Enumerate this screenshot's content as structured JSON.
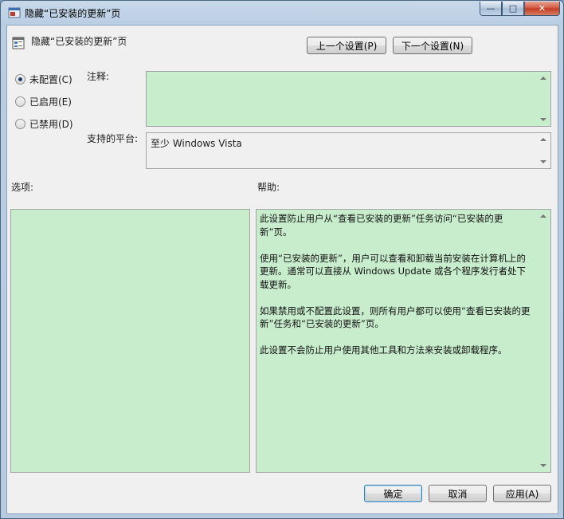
{
  "window": {
    "title": "隐藏“已安装的更新”页",
    "caption": {
      "minimize": "—",
      "maximize": "□",
      "close": "✕"
    }
  },
  "header": {
    "policy_title": "隐藏“已安装的更新”页",
    "prev_button": "上一个设置(P)",
    "next_button": "下一个设置(N)"
  },
  "state": {
    "options": [
      {
        "label": "未配置(C)",
        "selected": true
      },
      {
        "label": "已启用(E)",
        "selected": false
      },
      {
        "label": "已禁用(D)",
        "selected": false
      }
    ]
  },
  "comment": {
    "label": "注释:",
    "value": ""
  },
  "platform": {
    "label": "支持的平台:",
    "value": "至少 Windows Vista"
  },
  "options_section": {
    "label": "选项:"
  },
  "help_section": {
    "label": "帮助:",
    "paragraphs": [
      "此设置防止用户从“查看已安装的更新”任务访问“已安装的更新”页。",
      "使用“已安装的更新”，用户可以查看和卸载当前安装在计算机上的更新。通常可以直接从 Windows Update 或各个程序发行者处下载更新。",
      "如果禁用或不配置此设置，则所有用户都可以使用“查看已安装的更新”任务和“已安装的更新”页。",
      "此设置不会防止用户使用其他工具和方法来安装或卸载程序。"
    ]
  },
  "footer": {
    "ok": "确定",
    "cancel": "取消",
    "apply": "应用(A)"
  },
  "colors": {
    "panel_bg": "#c7edcc",
    "dialog_bg": "#f0f0f0",
    "frame": "#b9cde3"
  },
  "icons": {
    "window": "policy-window-icon",
    "policy": "policy-setting-icon"
  }
}
